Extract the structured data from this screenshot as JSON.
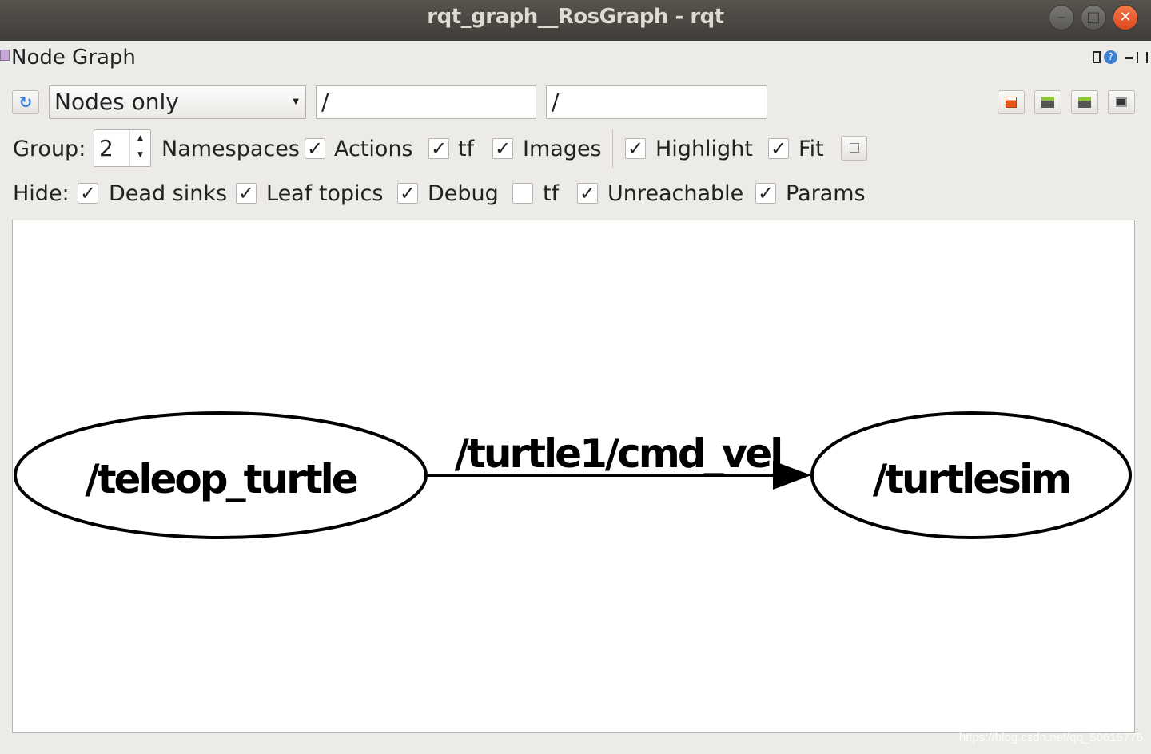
{
  "window": {
    "title": "rqt_graph__RosGraph - rqt"
  },
  "plugin": {
    "title": "Node Graph"
  },
  "toolbar": {
    "mode": "Nodes only",
    "node_filter": "/",
    "topic_filter": "/"
  },
  "options": {
    "group_label": "Group:",
    "group_value": "2",
    "items": [
      {
        "label": "Namespaces",
        "checked": true
      },
      {
        "label": "Actions",
        "checked": true
      },
      {
        "label": "tf",
        "checked": true
      },
      {
        "label": "Images",
        "checked": true
      },
      {
        "label": "Highlight",
        "checked": true
      },
      {
        "label": "Fit",
        "checked": true
      }
    ]
  },
  "hide": {
    "label": "Hide:",
    "items": [
      {
        "label": "Dead sinks",
        "checked": true
      },
      {
        "label": "Leaf topics",
        "checked": true
      },
      {
        "label": "Debug",
        "checked": true
      },
      {
        "label": "tf",
        "checked": false
      },
      {
        "label": "Unreachable",
        "checked": true
      },
      {
        "label": "Params",
        "checked": true
      }
    ]
  },
  "graph": {
    "nodes": [
      "/teleop_turtle",
      "/turtlesim"
    ],
    "edge": {
      "from": "/teleop_turtle",
      "to": "/turtlesim",
      "label": "/turtle1/cmd_vel"
    }
  },
  "watermark": "https://blog.csdn.net/qq_50615776"
}
